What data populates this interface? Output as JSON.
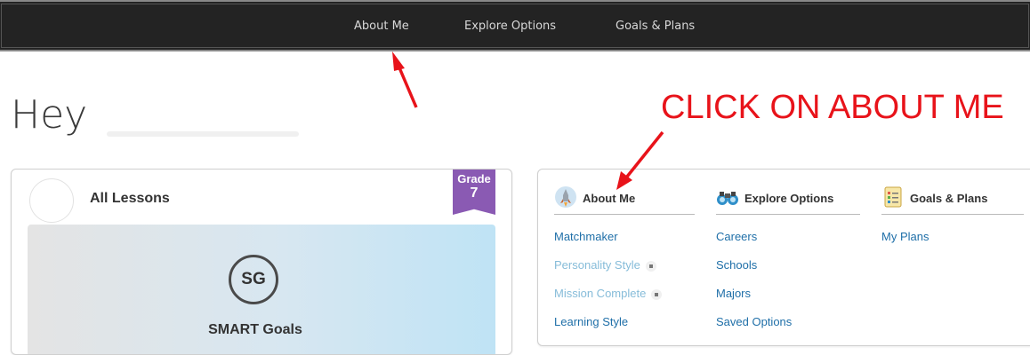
{
  "topnav": {
    "items": [
      {
        "label": "About Me"
      },
      {
        "label": "Explore Options"
      },
      {
        "label": "Goals & Plans"
      }
    ]
  },
  "greeting": "Hey",
  "annotation": {
    "text": "CLICK ON ABOUT ME",
    "color": "#e8131a"
  },
  "lessons_card": {
    "title": "All Lessons",
    "grade_label": "Grade",
    "grade_value": "7",
    "lesson": {
      "badge": "SG",
      "title": "SMART Goals"
    }
  },
  "menu_card": {
    "columns": [
      {
        "heading": "About Me",
        "icon": "rocket-icon",
        "items": [
          {
            "label": "Matchmaker",
            "locked": false
          },
          {
            "label": "Personality Style",
            "locked": true
          },
          {
            "label": "Mission Complete",
            "locked": true
          },
          {
            "label": "Learning Style",
            "locked": false
          }
        ]
      },
      {
        "heading": "Explore Options",
        "icon": "binoculars-icon",
        "items": [
          {
            "label": "Careers",
            "locked": false
          },
          {
            "label": "Schools",
            "locked": false
          },
          {
            "label": "Majors",
            "locked": false
          },
          {
            "label": "Saved Options",
            "locked": false
          }
        ]
      },
      {
        "heading": "Goals & Plans",
        "icon": "checklist-icon",
        "items": [
          {
            "label": "My Plans",
            "locked": false
          }
        ]
      }
    ]
  },
  "colors": {
    "topbar": "#232323",
    "link": "#1f6fa8",
    "link_locked": "#86bcd9",
    "grade_badge": "#8a5ab3"
  }
}
